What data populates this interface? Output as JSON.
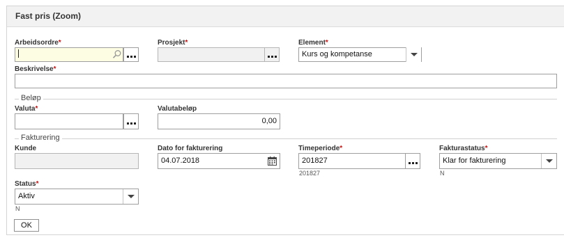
{
  "panel": {
    "title": "Fast pris (Zoom)"
  },
  "required_mark": "*",
  "fields": {
    "arbeidsordre": {
      "label": "Arbeidsordre",
      "value": ""
    },
    "prosjekt": {
      "label": "Prosjekt",
      "value": ""
    },
    "element": {
      "label": "Element",
      "value": "Kurs og kompetanse"
    },
    "beskrivelse": {
      "label": "Beskrivelse",
      "value": ""
    },
    "valuta": {
      "label": "Valuta",
      "value": ""
    },
    "valutabelop": {
      "label": "Valutabeløp",
      "value": "0,00"
    },
    "kunde": {
      "label": "Kunde",
      "value": ""
    },
    "dato": {
      "label": "Dato for fakturering",
      "value": "04.07.2018"
    },
    "timeperiode": {
      "label": "Timeperiode",
      "value": "201827",
      "sub": "201827"
    },
    "fakturastatus": {
      "label": "Fakturastatus",
      "value": "Klar for fakturering",
      "sub": "N"
    },
    "status": {
      "label": "Status",
      "value": "Aktiv",
      "sub": "N"
    }
  },
  "sections": {
    "belop": "Beløp",
    "fakturering": "Fakturering"
  },
  "buttons": {
    "ok": "OK"
  },
  "icons": {
    "search": "magnifier-icon",
    "lookup": "ellipsis-icon",
    "dropdown": "chevron-down-icon",
    "calendar": "calendar-icon"
  }
}
